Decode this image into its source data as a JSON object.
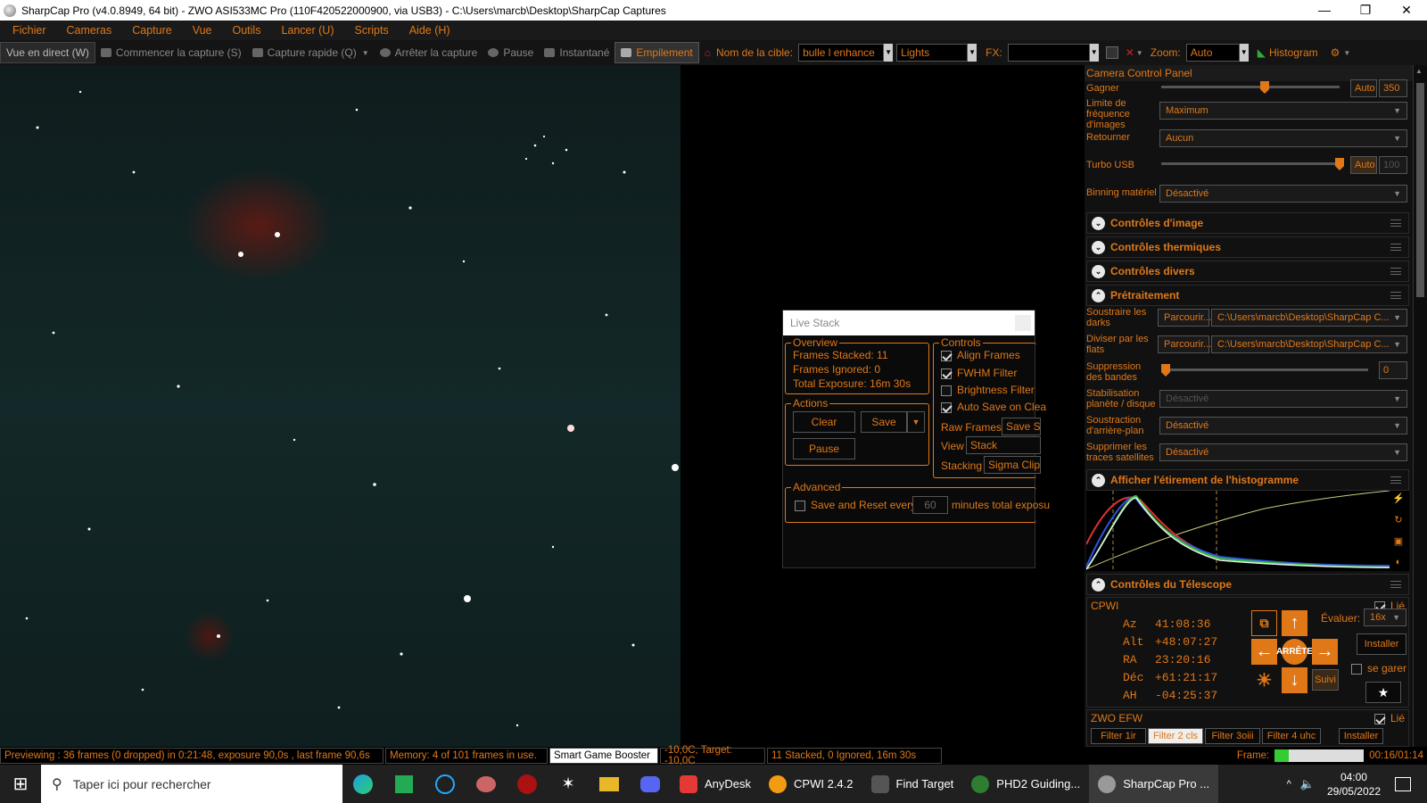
{
  "window": {
    "title": "SharpCap Pro (v4.0.8949, 64 bit) - ZWO ASI533MC Pro (110F420522000900, via USB3) - C:\\Users\\marcb\\Desktop\\SharpCap Captures",
    "minimize": "—",
    "maximize": "❐",
    "close": "✕"
  },
  "menu": [
    "Fichier",
    "Cameras",
    "Capture",
    "Vue",
    "Outils",
    "Lancer (U)",
    "Scripts",
    "Aide (H)"
  ],
  "toolbar": {
    "live_view": "Vue en direct (W)",
    "start_capture": "Commencer la capture (S)",
    "quick_capture": "Capture rapide (Q)",
    "stop_capture": "Arrêter la capture",
    "pause": "Pause",
    "snapshot": "Instantané",
    "stacking": "Empilement",
    "target_label": "Nom de la cible:",
    "target_value": "bulle l enhance",
    "frame_type": "Lights",
    "fx_label": "FX:",
    "zoom_label": "Zoom:",
    "zoom_value": "Auto",
    "histogram": "Histogram"
  },
  "live_stack": {
    "title": "Live Stack",
    "overview_title": "Overview",
    "frames_stacked_label": "Frames Stacked:",
    "frames_stacked": "11",
    "frames_ignored_label": "Frames Ignored:",
    "frames_ignored": "0",
    "total_exposure_label": "Total Exposure:",
    "total_exposure": "16m 30s",
    "actions_title": "Actions",
    "clear": "Clear",
    "save": "Save",
    "pause": "Pause",
    "controls_title": "Controls",
    "align_frames": "Align Frames",
    "fwhm_filter": "FWHM Filter",
    "brightness_filter": "Brightness Filter",
    "auto_save": "Auto Save on Clea",
    "raw_frames_label": "Raw Frames",
    "raw_frames_value": "Save St",
    "view_label": "View",
    "view_value": "Stack",
    "stacking_label": "Stacking",
    "stacking_value": "Sigma Clipp",
    "advanced_title": "Advanced",
    "save_reset_label": "Save and Reset every",
    "save_reset_value": "60",
    "minutes_label": "minutes total exposu"
  },
  "panel": {
    "title": "Camera Control Panel",
    "gain_label": "Gagner",
    "gain_auto": "Auto",
    "gain_value": "350",
    "gain_level": 0.58,
    "framerate_label": "Limite de fréquence d'images",
    "framerate_value": "Maximum",
    "flip_label": "Retourner",
    "flip_value": "Aucun",
    "turbo_label": "Turbo USB",
    "turbo_auto": "Auto",
    "turbo_value": "100",
    "turbo_level": 1.0,
    "binning_label": "Binning matériel",
    "binning_value": "Désactivé",
    "sections": {
      "image_controls": "Contrôles d'image",
      "thermal_controls": "Contrôles thermiques",
      "misc_controls": "Contrôles divers",
      "preprocessing": "Prétraitement",
      "histogram_stretch": "Afficher l'étirement de l'histogramme",
      "telescope_controls": "Contrôles du Télescope"
    },
    "darks_label": "Soustraire les darks",
    "browse": "Parcourir...",
    "darks_path": "C:\\Users\\marcb\\Desktop\\SharpCap C...",
    "flats_label": "Diviser par les flats",
    "flats_path": "C:\\Users\\marcb\\Desktop\\SharpCap C...",
    "banding_label": "Suppression des bandes",
    "banding_value": "0",
    "planet_stab_label": "Stabilisation planète / disque",
    "planet_stab_value": "Désactivé",
    "bg_sub_label": "Soustraction d'arrière-plan",
    "bg_sub_value": "Désactivé",
    "sat_label": "Supprimer les traces satellites",
    "sat_value": "Désactivé",
    "mount_name": "CPWI",
    "linked": "Lié",
    "az_label": "Az",
    "az_value": "41:08:36",
    "alt_label": "Alt",
    "alt_value": "+48:07:27",
    "ra_label": "RA",
    "ra_value": "23:20:16",
    "dec_label": "Déc",
    "dec_value": "+61:21:17",
    "ah_label": "AH",
    "ah_value": "-04:25:37",
    "rate_label": "Évaluer:",
    "rate_value": "16x",
    "install": "Installer",
    "park": "se garer",
    "stop": "ARRÊTE",
    "track": "Suivi",
    "efw_name": "ZWO EFW",
    "filters": [
      "Filter 1ir",
      "Filter 2 cls",
      "Filter 3oiii",
      "Filter 4 uhc"
    ],
    "efw_install": "Installer"
  },
  "status": {
    "preview": "Previewing : 36 frames (0 dropped) in 0:21:48, exposure 90,0s , last frame 90,6s",
    "memory": "Memory: 4 of 101 frames in use.",
    "tooltip": "Smart Game Booster",
    "temp": "-10,0C, Target: -10,0C",
    "stack": "11 Stacked, 0 Ignored, 16m 30s",
    "frame_label": "Frame:",
    "frame_progress": 0.16,
    "time": "00:16/01:14"
  },
  "taskbar": {
    "search_placeholder": "Taper ici pour rechercher",
    "apps": [
      "AnyDesk",
      "CPWI 2.4.2",
      "Find Target",
      "PHD2 Guiding...",
      "SharpCap Pro ..."
    ],
    "clock_time": "04:00",
    "clock_date": "29/05/2022"
  }
}
